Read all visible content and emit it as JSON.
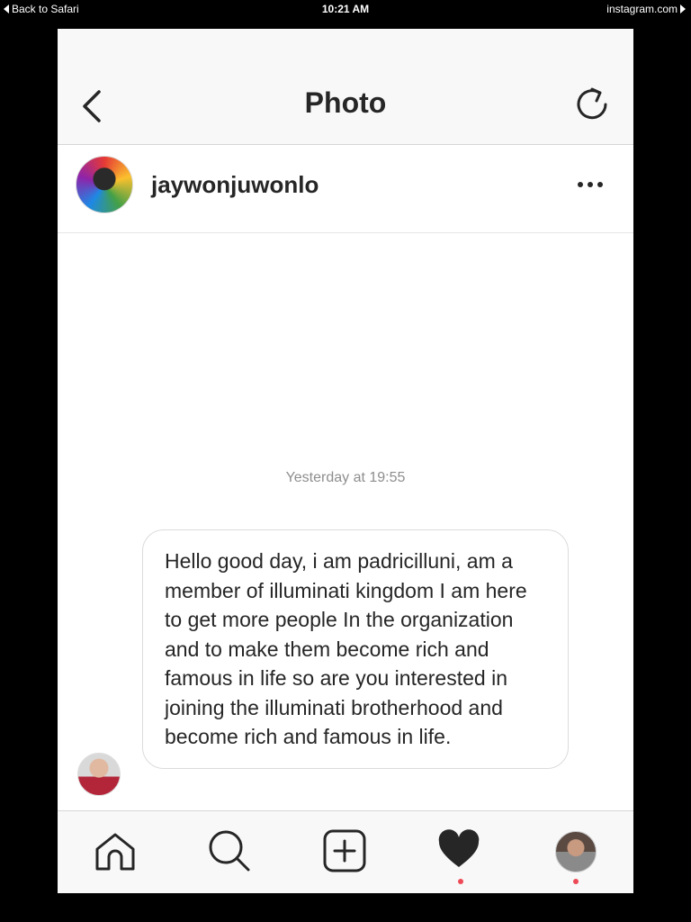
{
  "status_bar": {
    "back_label": "Back to Safari",
    "time": "10:21 AM",
    "domain": "instagram.com"
  },
  "header": {
    "title": "Photo",
    "back_icon": "chevron-left-icon",
    "refresh_icon": "refresh-icon"
  },
  "profile": {
    "username": "jaywonjuwonlo",
    "more_icon": "more-horizontal-icon"
  },
  "message": {
    "timestamp": "Yesterday at 19:55",
    "text": "Hello good day, i am padricilluni,  am a member of illuminati kingdom I am here to get more people In the organization and to make them become rich and famous in life so are you interested in joining the illuminati brotherhood and become rich and famous in life."
  },
  "tab_bar": {
    "tabs": [
      "home-icon",
      "search-icon",
      "add-icon",
      "heart-icon",
      "profile-avatar"
    ],
    "active": "heart-icon",
    "notification_color": "#ed4956"
  },
  "colors": {
    "text": "#262626",
    "muted": "#8e8e8e",
    "background": "#000000",
    "notification": "#ed4956"
  }
}
